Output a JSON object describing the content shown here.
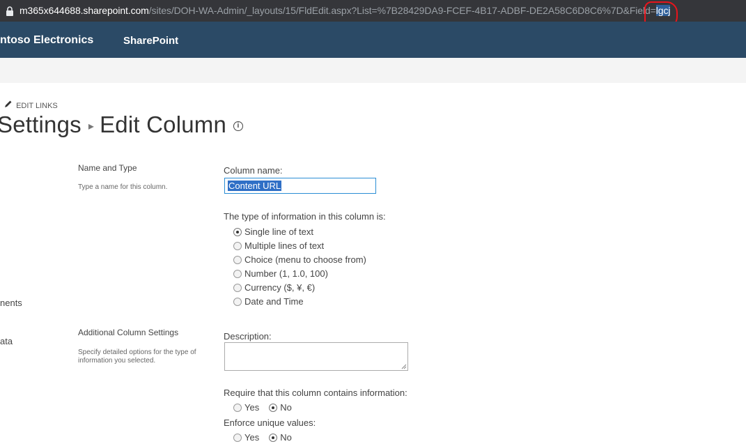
{
  "browser": {
    "url_host": "m365x644688.sharepoint.com",
    "url_path": "/sites/DOH-WA-Admin/_layouts/15/FldEdit.aspx?List=%7B28429DA9-FCEF-4B17-ADBF-DE2A58C6D8C6%7D&Field=",
    "url_selected": "lgcj",
    "lock_icon": "lock-icon"
  },
  "suitebar": {
    "org_name": "ntoso Electronics",
    "app_name": "SharePoint"
  },
  "edit_links": {
    "label": "EDIT LINKS",
    "icon": "pencil-icon"
  },
  "page_title": {
    "parent": "Settings",
    "separator": "▸",
    "current": "Edit Column",
    "info_icon": "info-icon"
  },
  "left_nav": {
    "item_1": "nents",
    "item_2": "ata"
  },
  "name_and_type": {
    "title": "Name and Type",
    "description": "Type a name for this column.",
    "column_name_label": "Column name:",
    "column_name_value": "Content URL",
    "type_label": "The type of information in this column is:",
    "types": [
      {
        "label": "Single line of text",
        "selected": true
      },
      {
        "label": "Multiple lines of text",
        "selected": false
      },
      {
        "label": "Choice (menu to choose from)",
        "selected": false
      },
      {
        "label": "Number (1, 1.0, 100)",
        "selected": false
      },
      {
        "label": "Currency ($, ¥, €)",
        "selected": false
      },
      {
        "label": "Date and Time",
        "selected": false
      }
    ]
  },
  "additional_settings": {
    "title": "Additional Column Settings",
    "description": "Specify detailed options for the type of information you selected.",
    "description_label": "Description:",
    "require_label": "Require that this column contains information:",
    "require_yes": "Yes",
    "require_no": "No",
    "require_value": "No",
    "unique_label": "Enforce unique values:",
    "unique_yes": "Yes",
    "unique_no": "No",
    "unique_value": "No"
  },
  "colors": {
    "suitebar_bg": "#2b4a66",
    "addressbar_bg": "#35363a",
    "selection": "#2f6fc6",
    "annotation": "#e8141c"
  }
}
